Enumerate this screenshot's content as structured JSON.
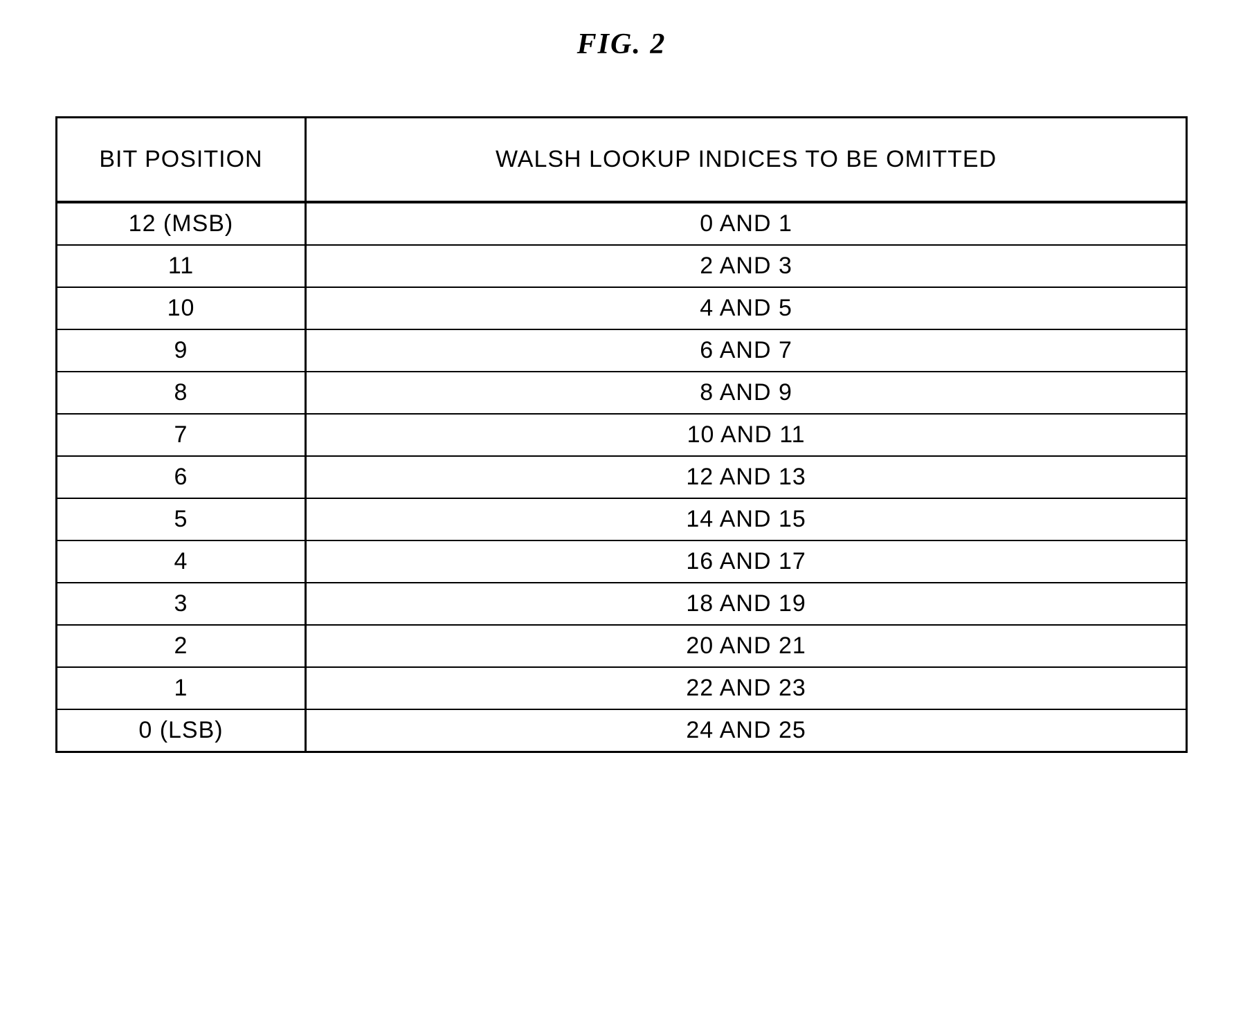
{
  "figure": {
    "title": "FIG.  2"
  },
  "table": {
    "headers": {
      "col1": "BIT POSITION",
      "col2": "WALSH LOOKUP INDICES TO BE OMITTED"
    },
    "rows": [
      {
        "bit": "12 (MSB)",
        "indices": "0 AND 1"
      },
      {
        "bit": "11",
        "indices": "2 AND 3"
      },
      {
        "bit": "10",
        "indices": "4 AND 5"
      },
      {
        "bit": "9",
        "indices": "6 AND 7"
      },
      {
        "bit": "8",
        "indices": "8 AND 9"
      },
      {
        "bit": "7",
        "indices": "10 AND 11"
      },
      {
        "bit": "6",
        "indices": "12 AND 13"
      },
      {
        "bit": "5",
        "indices": "14 AND 15"
      },
      {
        "bit": "4",
        "indices": "16 AND 17"
      },
      {
        "bit": "3",
        "indices": "18 AND 19"
      },
      {
        "bit": "2",
        "indices": "20 AND 21"
      },
      {
        "bit": "1",
        "indices": "22 AND 23"
      },
      {
        "bit": "0 (LSB)",
        "indices": "24 AND 25"
      }
    ]
  }
}
